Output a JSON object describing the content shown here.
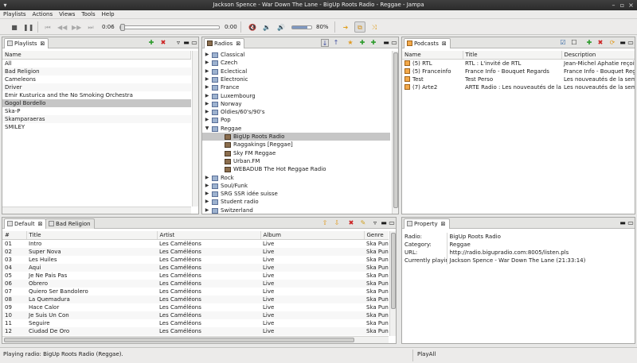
{
  "window": {
    "title": "Jackson Spence - War Down The Lane - BigUp Roots Radio - Reggae - Jampa"
  },
  "menu": [
    "Playlists",
    "Actions",
    "Views",
    "Tools",
    "Help"
  ],
  "toolbar": {
    "elapsed": "0:06",
    "remaining": "0:00",
    "volume_label": "80%",
    "progress": 0.0,
    "volume": 0.8
  },
  "playlists": {
    "tab_label": "Playlists",
    "header": "Name",
    "items": [
      "All",
      "Bad Religion",
      "Cameleons",
      "Driver",
      "Emir Kusturica and the No Smoking Orchestra",
      "Gogol Bordello",
      "Ska-P",
      "Skamparaeras",
      "SMILEY"
    ],
    "selected_index": 5
  },
  "radios": {
    "tab_label": "Radios",
    "tree": [
      {
        "label": "Classical",
        "level": 0,
        "expanded": false
      },
      {
        "label": "Czech",
        "level": 0,
        "expanded": false
      },
      {
        "label": "Eclectical",
        "level": 0,
        "expanded": false
      },
      {
        "label": "Electronic",
        "level": 0,
        "expanded": false
      },
      {
        "label": "France",
        "level": 0,
        "expanded": false
      },
      {
        "label": "Luxembourg",
        "level": 0,
        "expanded": false
      },
      {
        "label": "Norway",
        "level": 0,
        "expanded": false
      },
      {
        "label": "Oldies/60's/90's",
        "level": 0,
        "expanded": false
      },
      {
        "label": "Pop",
        "level": 0,
        "expanded": false
      },
      {
        "label": "Reggae",
        "level": 0,
        "expanded": true
      },
      {
        "label": "BigUp Roots Radio",
        "level": 1,
        "selected": true
      },
      {
        "label": "Raggakings [Reggae]",
        "level": 1
      },
      {
        "label": "Sky FM Reggae",
        "level": 1
      },
      {
        "label": "Urban.FM",
        "level": 1
      },
      {
        "label": "WEBADUB The Hot Reggae Radio",
        "level": 1
      },
      {
        "label": "Rock",
        "level": 0,
        "expanded": false
      },
      {
        "label": "Soul/Funk",
        "level": 0,
        "expanded": false
      },
      {
        "label": "SRG SSR idée suisse",
        "level": 0,
        "expanded": false
      },
      {
        "label": "Student radio",
        "level": 0,
        "expanded": false
      },
      {
        "label": "Switzerland",
        "level": 0,
        "expanded": false
      }
    ]
  },
  "podcasts": {
    "tab_label": "Podcasts",
    "columns": [
      "Name",
      "Title",
      "Description"
    ],
    "rows": [
      [
        "(5) RTL",
        "RTL : L'invité de RTL",
        "Jean-Michel Aphatie reçoit un"
      ],
      [
        "(5) Franceinfo",
        "France Info - Bouquet Regards",
        "France Info - Bouquet Regards"
      ],
      [
        "Test",
        "Test Perso",
        "Les nouveautés de la semain"
      ],
      [
        "(7) Arte2",
        "ARTE Radio : Les nouveautés de la semai",
        "Les nouveautés de la semain"
      ]
    ]
  },
  "tracks": {
    "tab_default": "Default",
    "tab_other": "Bad Religion",
    "columns": [
      "#",
      "Title",
      "Artist",
      "Album",
      "Genre"
    ],
    "rows": [
      [
        "01",
        "Intro",
        "Les Caméléons",
        "Live",
        "Ska Punk"
      ],
      [
        "02",
        "Super Nova",
        "Les Caméléons",
        "Live",
        "Ska Punk"
      ],
      [
        "03",
        "Les Huiles",
        "Les Caméléons",
        "Live",
        "Ska Punk"
      ],
      [
        "04",
        "Aqui",
        "Les Caméléons",
        "Live",
        "Ska Punk"
      ],
      [
        "05",
        "Je Ne Pais Pas",
        "Les Caméléons",
        "Live",
        "Ska Punk"
      ],
      [
        "06",
        "Obrero",
        "Les Caméléons",
        "Live",
        "Ska Punk"
      ],
      [
        "07",
        "Quiero Ser Bandolero",
        "Les Caméléons",
        "Live",
        "Ska Punk"
      ],
      [
        "08",
        "La Quemadura",
        "Les Caméléons",
        "Live",
        "Ska Punk"
      ],
      [
        "09",
        "Hace Calor",
        "Les Caméléons",
        "Live",
        "Ska Punk"
      ],
      [
        "10",
        "Je Suis Un Con",
        "Les Caméléons",
        "Live",
        "Ska Punk"
      ],
      [
        "11",
        "Seguire",
        "Les Caméléons",
        "Live",
        "Ska Punk"
      ],
      [
        "12",
        "Ciudad De Oro",
        "Les Caméléons",
        "Live",
        "Ska Punk"
      ]
    ]
  },
  "property": {
    "tab_label": "Property",
    "rows": [
      [
        "Radio:",
        "BigUp Roots Radio"
      ],
      [
        "Category:",
        "Reggae"
      ],
      [
        "URL:",
        "http://radio.bigupradio.com:8005/listen.pls"
      ],
      [
        "Currently playing:",
        "Jackson Spence - War Down The Lane (21:33:14)"
      ]
    ]
  },
  "status": {
    "left": "Playing radio: BigUp Roots Radio (Reggae).",
    "right": "PlayAll"
  },
  "colors": {
    "selection": "#c6c6c6",
    "accent_orange": "#f0a830",
    "red": "#cc2222",
    "green": "#2a9a2a"
  }
}
